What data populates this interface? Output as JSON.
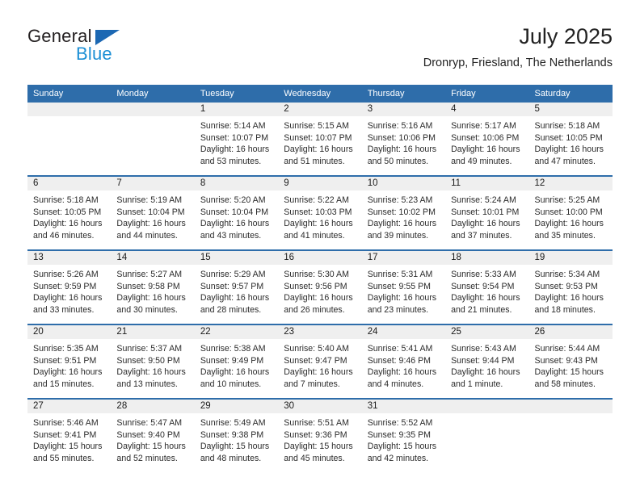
{
  "brand": {
    "name_top": "General",
    "name_bottom": "Blue",
    "triangle_color": "#1c68b3",
    "blue_text_color": "#1c8fd5"
  },
  "header": {
    "title": "July 2025",
    "subtitle": "Dronryp, Friesland, The Netherlands"
  },
  "theme": {
    "header_blue": "#2e6daa",
    "daynum_band": "#efefef",
    "row_divider": "#2e6daa"
  },
  "weekday_headers": [
    "Sunday",
    "Monday",
    "Tuesday",
    "Wednesday",
    "Thursday",
    "Friday",
    "Saturday"
  ],
  "weeks": [
    [
      {
        "day": "",
        "sunrise": "",
        "sunset": "",
        "daylight_line1": "",
        "daylight_line2": ""
      },
      {
        "day": "",
        "sunrise": "",
        "sunset": "",
        "daylight_line1": "",
        "daylight_line2": ""
      },
      {
        "day": "1",
        "sunrise": "Sunrise: 5:14 AM",
        "sunset": "Sunset: 10:07 PM",
        "daylight_line1": "Daylight: 16 hours",
        "daylight_line2": "and 53 minutes."
      },
      {
        "day": "2",
        "sunrise": "Sunrise: 5:15 AM",
        "sunset": "Sunset: 10:07 PM",
        "daylight_line1": "Daylight: 16 hours",
        "daylight_line2": "and 51 minutes."
      },
      {
        "day": "3",
        "sunrise": "Sunrise: 5:16 AM",
        "sunset": "Sunset: 10:06 PM",
        "daylight_line1": "Daylight: 16 hours",
        "daylight_line2": "and 50 minutes."
      },
      {
        "day": "4",
        "sunrise": "Sunrise: 5:17 AM",
        "sunset": "Sunset: 10:06 PM",
        "daylight_line1": "Daylight: 16 hours",
        "daylight_line2": "and 49 minutes."
      },
      {
        "day": "5",
        "sunrise": "Sunrise: 5:18 AM",
        "sunset": "Sunset: 10:05 PM",
        "daylight_line1": "Daylight: 16 hours",
        "daylight_line2": "and 47 minutes."
      }
    ],
    [
      {
        "day": "6",
        "sunrise": "Sunrise: 5:18 AM",
        "sunset": "Sunset: 10:05 PM",
        "daylight_line1": "Daylight: 16 hours",
        "daylight_line2": "and 46 minutes."
      },
      {
        "day": "7",
        "sunrise": "Sunrise: 5:19 AM",
        "sunset": "Sunset: 10:04 PM",
        "daylight_line1": "Daylight: 16 hours",
        "daylight_line2": "and 44 minutes."
      },
      {
        "day": "8",
        "sunrise": "Sunrise: 5:20 AM",
        "sunset": "Sunset: 10:04 PM",
        "daylight_line1": "Daylight: 16 hours",
        "daylight_line2": "and 43 minutes."
      },
      {
        "day": "9",
        "sunrise": "Sunrise: 5:22 AM",
        "sunset": "Sunset: 10:03 PM",
        "daylight_line1": "Daylight: 16 hours",
        "daylight_line2": "and 41 minutes."
      },
      {
        "day": "10",
        "sunrise": "Sunrise: 5:23 AM",
        "sunset": "Sunset: 10:02 PM",
        "daylight_line1": "Daylight: 16 hours",
        "daylight_line2": "and 39 minutes."
      },
      {
        "day": "11",
        "sunrise": "Sunrise: 5:24 AM",
        "sunset": "Sunset: 10:01 PM",
        "daylight_line1": "Daylight: 16 hours",
        "daylight_line2": "and 37 minutes."
      },
      {
        "day": "12",
        "sunrise": "Sunrise: 5:25 AM",
        "sunset": "Sunset: 10:00 PM",
        "daylight_line1": "Daylight: 16 hours",
        "daylight_line2": "and 35 minutes."
      }
    ],
    [
      {
        "day": "13",
        "sunrise": "Sunrise: 5:26 AM",
        "sunset": "Sunset: 9:59 PM",
        "daylight_line1": "Daylight: 16 hours",
        "daylight_line2": "and 33 minutes."
      },
      {
        "day": "14",
        "sunrise": "Sunrise: 5:27 AM",
        "sunset": "Sunset: 9:58 PM",
        "daylight_line1": "Daylight: 16 hours",
        "daylight_line2": "and 30 minutes."
      },
      {
        "day": "15",
        "sunrise": "Sunrise: 5:29 AM",
        "sunset": "Sunset: 9:57 PM",
        "daylight_line1": "Daylight: 16 hours",
        "daylight_line2": "and 28 minutes."
      },
      {
        "day": "16",
        "sunrise": "Sunrise: 5:30 AM",
        "sunset": "Sunset: 9:56 PM",
        "daylight_line1": "Daylight: 16 hours",
        "daylight_line2": "and 26 minutes."
      },
      {
        "day": "17",
        "sunrise": "Sunrise: 5:31 AM",
        "sunset": "Sunset: 9:55 PM",
        "daylight_line1": "Daylight: 16 hours",
        "daylight_line2": "and 23 minutes."
      },
      {
        "day": "18",
        "sunrise": "Sunrise: 5:33 AM",
        "sunset": "Sunset: 9:54 PM",
        "daylight_line1": "Daylight: 16 hours",
        "daylight_line2": "and 21 minutes."
      },
      {
        "day": "19",
        "sunrise": "Sunrise: 5:34 AM",
        "sunset": "Sunset: 9:53 PM",
        "daylight_line1": "Daylight: 16 hours",
        "daylight_line2": "and 18 minutes."
      }
    ],
    [
      {
        "day": "20",
        "sunrise": "Sunrise: 5:35 AM",
        "sunset": "Sunset: 9:51 PM",
        "daylight_line1": "Daylight: 16 hours",
        "daylight_line2": "and 15 minutes."
      },
      {
        "day": "21",
        "sunrise": "Sunrise: 5:37 AM",
        "sunset": "Sunset: 9:50 PM",
        "daylight_line1": "Daylight: 16 hours",
        "daylight_line2": "and 13 minutes."
      },
      {
        "day": "22",
        "sunrise": "Sunrise: 5:38 AM",
        "sunset": "Sunset: 9:49 PM",
        "daylight_line1": "Daylight: 16 hours",
        "daylight_line2": "and 10 minutes."
      },
      {
        "day": "23",
        "sunrise": "Sunrise: 5:40 AM",
        "sunset": "Sunset: 9:47 PM",
        "daylight_line1": "Daylight: 16 hours",
        "daylight_line2": "and 7 minutes."
      },
      {
        "day": "24",
        "sunrise": "Sunrise: 5:41 AM",
        "sunset": "Sunset: 9:46 PM",
        "daylight_line1": "Daylight: 16 hours",
        "daylight_line2": "and 4 minutes."
      },
      {
        "day": "25",
        "sunrise": "Sunrise: 5:43 AM",
        "sunset": "Sunset: 9:44 PM",
        "daylight_line1": "Daylight: 16 hours",
        "daylight_line2": "and 1 minute."
      },
      {
        "day": "26",
        "sunrise": "Sunrise: 5:44 AM",
        "sunset": "Sunset: 9:43 PM",
        "daylight_line1": "Daylight: 15 hours",
        "daylight_line2": "and 58 minutes."
      }
    ],
    [
      {
        "day": "27",
        "sunrise": "Sunrise: 5:46 AM",
        "sunset": "Sunset: 9:41 PM",
        "daylight_line1": "Daylight: 15 hours",
        "daylight_line2": "and 55 minutes."
      },
      {
        "day": "28",
        "sunrise": "Sunrise: 5:47 AM",
        "sunset": "Sunset: 9:40 PM",
        "daylight_line1": "Daylight: 15 hours",
        "daylight_line2": "and 52 minutes."
      },
      {
        "day": "29",
        "sunrise": "Sunrise: 5:49 AM",
        "sunset": "Sunset: 9:38 PM",
        "daylight_line1": "Daylight: 15 hours",
        "daylight_line2": "and 48 minutes."
      },
      {
        "day": "30",
        "sunrise": "Sunrise: 5:51 AM",
        "sunset": "Sunset: 9:36 PM",
        "daylight_line1": "Daylight: 15 hours",
        "daylight_line2": "and 45 minutes."
      },
      {
        "day": "31",
        "sunrise": "Sunrise: 5:52 AM",
        "sunset": "Sunset: 9:35 PM",
        "daylight_line1": "Daylight: 15 hours",
        "daylight_line2": "and 42 minutes."
      },
      {
        "day": "",
        "sunrise": "",
        "sunset": "",
        "daylight_line1": "",
        "daylight_line2": ""
      },
      {
        "day": "",
        "sunrise": "",
        "sunset": "",
        "daylight_line1": "",
        "daylight_line2": ""
      }
    ]
  ]
}
